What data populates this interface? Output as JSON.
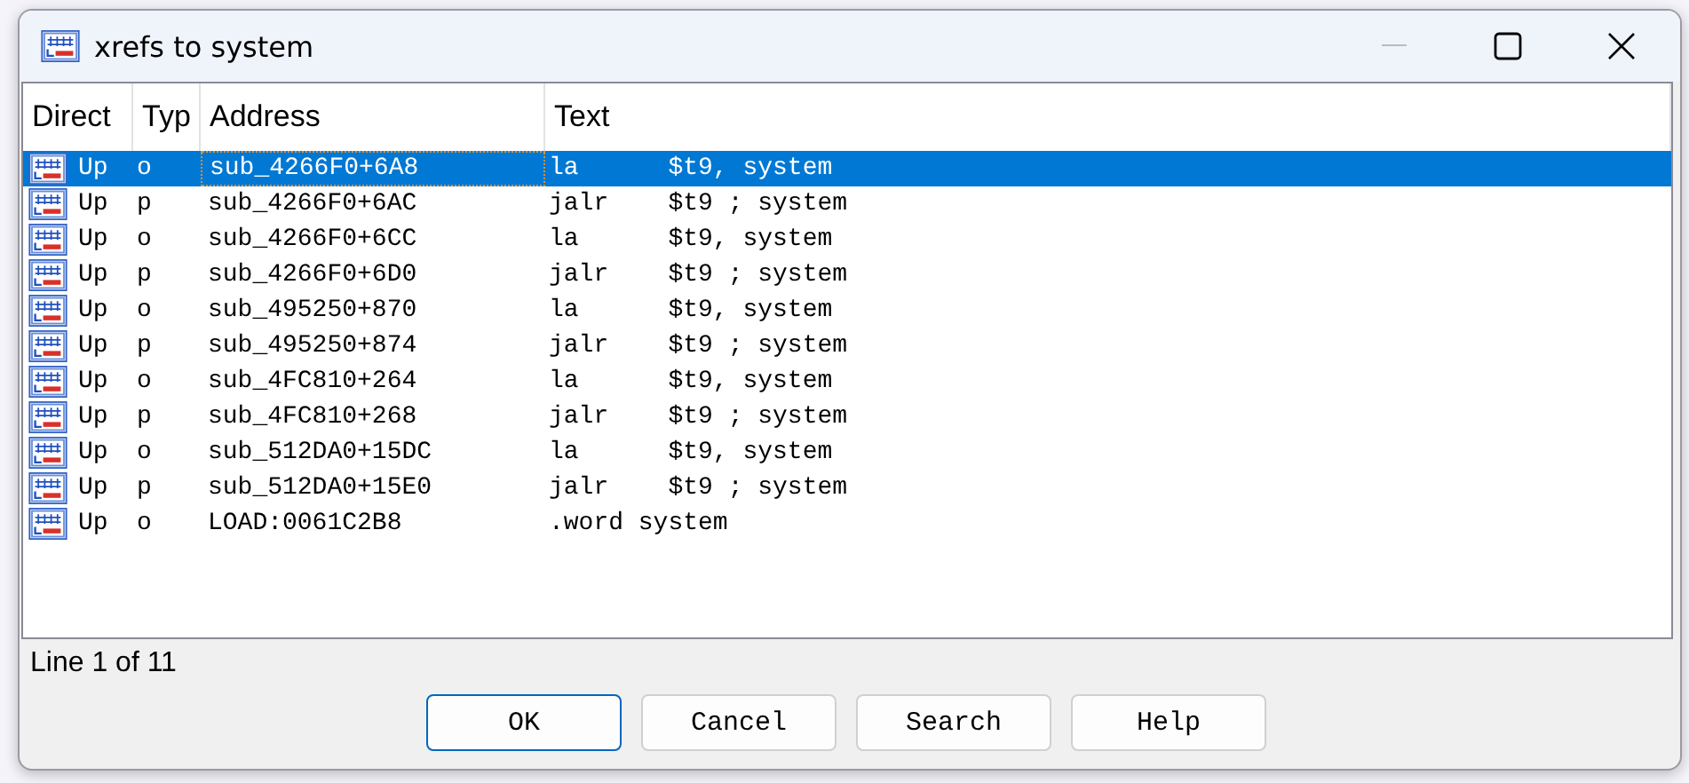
{
  "window": {
    "title": "xrefs to system"
  },
  "table": {
    "columns": [
      "Direct",
      "Typ",
      "Address",
      "Text"
    ],
    "rows": [
      {
        "direction": "Up",
        "type": "o",
        "address": "sub_4266F0+6A8",
        "text": "la      $t9, system",
        "selected": true
      },
      {
        "direction": "Up",
        "type": "p",
        "address": "sub_4266F0+6AC",
        "text": "jalr    $t9 ; system",
        "selected": false
      },
      {
        "direction": "Up",
        "type": "o",
        "address": "sub_4266F0+6CC",
        "text": "la      $t9, system",
        "selected": false
      },
      {
        "direction": "Up",
        "type": "p",
        "address": "sub_4266F0+6D0",
        "text": "jalr    $t9 ; system",
        "selected": false
      },
      {
        "direction": "Up",
        "type": "o",
        "address": "sub_495250+870",
        "text": "la      $t9, system",
        "selected": false
      },
      {
        "direction": "Up",
        "type": "p",
        "address": "sub_495250+874",
        "text": "jalr    $t9 ; system",
        "selected": false
      },
      {
        "direction": "Up",
        "type": "o",
        "address": "sub_4FC810+264",
        "text": "la      $t9, system",
        "selected": false
      },
      {
        "direction": "Up",
        "type": "p",
        "address": "sub_4FC810+268",
        "text": "jalr    $t9 ; system",
        "selected": false
      },
      {
        "direction": "Up",
        "type": "o",
        "address": "sub_512DA0+15DC",
        "text": "la      $t9, system",
        "selected": false
      },
      {
        "direction": "Up",
        "type": "p",
        "address": "sub_512DA0+15E0",
        "text": "jalr    $t9 ; system",
        "selected": false
      },
      {
        "direction": "Up",
        "type": "o",
        "address": "LOAD:0061C2B8",
        "text": ".word system",
        "selected": false
      }
    ]
  },
  "status_bar": "Line 1 of 11",
  "buttons": [
    {
      "label": "OK",
      "default": true
    },
    {
      "label": "Cancel",
      "default": false
    },
    {
      "label": "Search",
      "default": false
    },
    {
      "label": "Help",
      "default": false
    }
  ]
}
